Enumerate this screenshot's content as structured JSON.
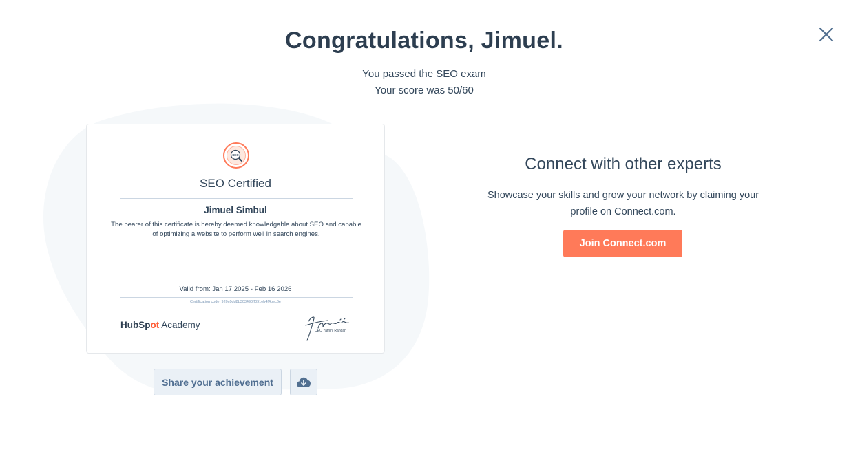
{
  "header": {
    "title": "Congratulations, Jimuel.",
    "passed_text": "You passed the SEO exam",
    "score_text": "Your score was 50/60"
  },
  "certificate": {
    "badge_text": "SEO",
    "title": "SEO Certified",
    "recipient": "Jimuel Simbul",
    "description": "The bearer of this certificate is hereby deemed knowledgable about SEO and capable of optimizing a website to perform well in search engines.",
    "valid_text": "Valid from: Jan 17 2025 - Feb 16 2026",
    "code_text": "Certification code: 920c0dd8b303490ff091eb4f4bec6e",
    "logo_hub": "HubSp",
    "logo_ot": "ot",
    "logo_academy": " Academy",
    "ceo_text": "CEO Yamini Rangan"
  },
  "actions": {
    "share_label": "Share your achievement",
    "download_icon": "cloud-download-icon"
  },
  "connect": {
    "title": "Connect with other experts",
    "description": "Showcase your skills and grow your network by claiming your profile on Connect.com.",
    "button_label": "Join Connect.com"
  },
  "colors": {
    "accent": "#ff7a59",
    "heading": "#2d3e50",
    "text": "#33475b",
    "blob": "#f5f8fa",
    "secondary_button_bg": "#eaf0f6"
  }
}
